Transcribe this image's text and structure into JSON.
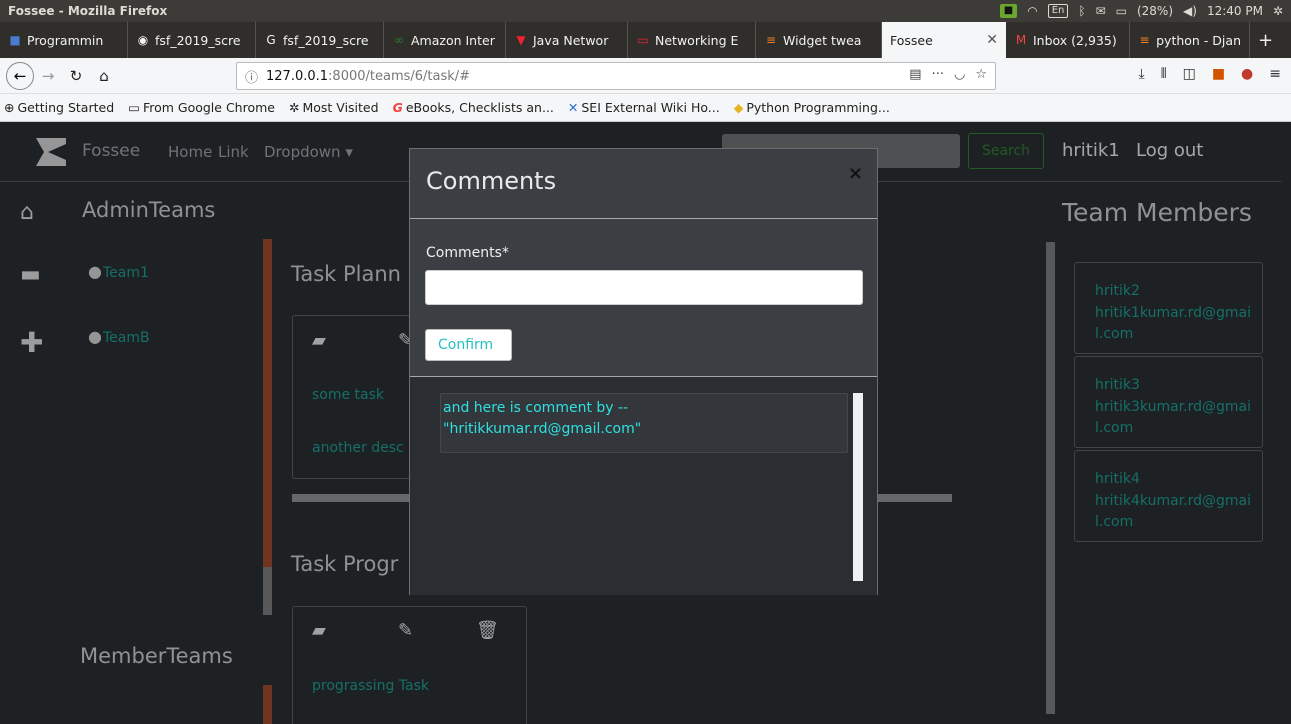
{
  "os": {
    "window_title": "Fossee - Mozilla Firefox",
    "keyboard": "En",
    "battery": "(28%)",
    "time": "12:40 PM"
  },
  "browser": {
    "tabs": [
      {
        "label": "Programmin",
        "icon": "page-icon"
      },
      {
        "label": "fsf_2019_scre",
        "icon": "github-icon"
      },
      {
        "label": "fsf_2019_scre",
        "icon": "google-icon"
      },
      {
        "label": "Amazon Inter",
        "icon": "green-icon"
      },
      {
        "label": "Java Networ",
        "icon": "v-icon"
      },
      {
        "label": "Networking E",
        "icon": "oracle-icon"
      },
      {
        "label": "Widget twea",
        "icon": "stack-icon"
      },
      {
        "label": "Fossee",
        "icon": "",
        "active": true
      },
      {
        "label": "Inbox (2,935)",
        "icon": "gmail-icon"
      },
      {
        "label": "python - Djan",
        "icon": "stack-icon"
      }
    ],
    "url_host": "127.0.0.1",
    "url_path": ":8000/teams/6/task/#",
    "bookmarks": [
      {
        "label": "Getting Started",
        "icon": "globe-icon"
      },
      {
        "label": "From Google Chrome",
        "icon": "folder-icon"
      },
      {
        "label": "Most Visited",
        "icon": "gear-icon"
      },
      {
        "label": "eBooks, Checklists an...",
        "icon": "g-icon"
      },
      {
        "label": "SEI External Wiki Ho...",
        "icon": "confluence-icon"
      },
      {
        "label": "Python Programming...",
        "icon": "python-icon"
      }
    ]
  },
  "app": {
    "brand": "Fossee",
    "nav": {
      "home": "Home",
      "link": "Link",
      "dropdown": "Dropdown ▾"
    },
    "search_button": "Search",
    "user": "hritik1",
    "logout": "Log out",
    "sidebar": {
      "admin_title": "AdminTeams",
      "teams": [
        "Team1",
        "TeamB"
      ],
      "member_title": "MemberTeams"
    },
    "sections": {
      "planning": "Task Plann",
      "progress": "Task Progr"
    },
    "planning_tasks": [
      "some task",
      "another desc"
    ],
    "progress_tasks": [
      "prograssing Task"
    ],
    "members_title": "Team Members",
    "members": [
      {
        "name": "hritik2",
        "email": "hritik1kumar.rd@gmail.com"
      },
      {
        "name": "hritik3",
        "email": "hritik3kumar.rd@gmail.com"
      },
      {
        "name": "hritik4",
        "email": "hritik4kumar.rd@gmail.com"
      }
    ]
  },
  "modal": {
    "title": "Comments",
    "close": "×",
    "label": "Comments*",
    "input_value": "",
    "confirm": "Confirm",
    "comments": [
      {
        "line1": "and here is comment by --",
        "line2": "\"hritikkumar.rd@gmail.com\""
      }
    ]
  },
  "colors": {
    "link": "#1e9a8f",
    "accent_cyan": "#2ee0e0",
    "page_bg": "#2a2e32",
    "brown_bar": "#9a4a2a"
  }
}
